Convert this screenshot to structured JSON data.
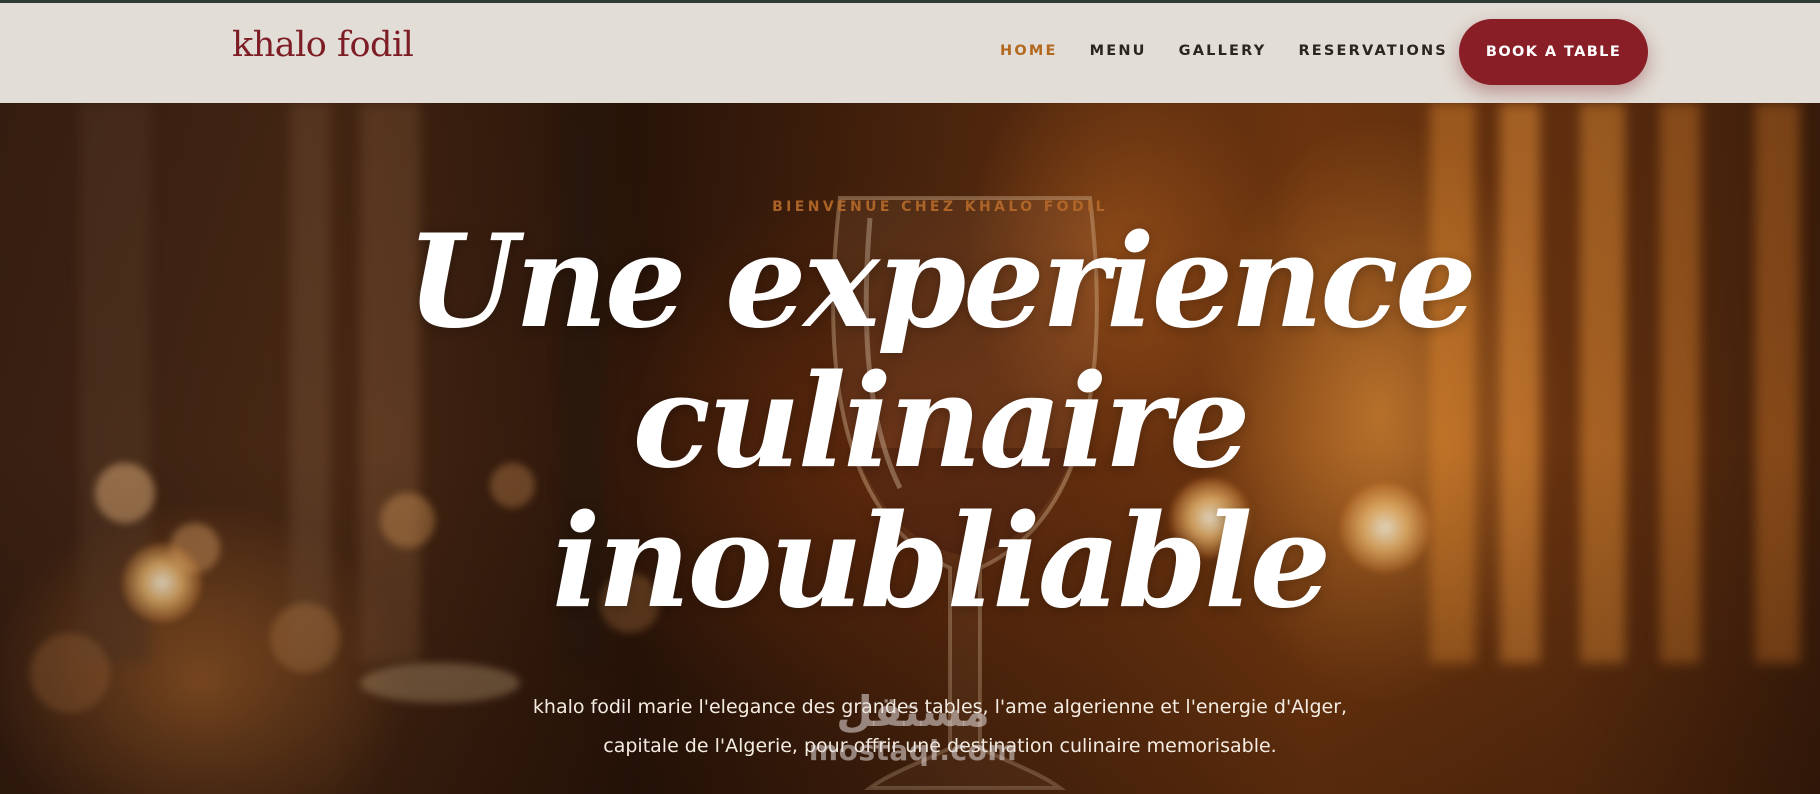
{
  "header": {
    "logo": "khalo fodil",
    "nav": [
      {
        "label": "HOME",
        "active": true
      },
      {
        "label": "MENU",
        "active": false
      },
      {
        "label": "GALLERY",
        "active": false
      },
      {
        "label": "RESERVATIONS",
        "active": false
      }
    ],
    "cta_label": "BOOK A TABLE"
  },
  "hero": {
    "eyebrow": "BIENVENUE CHEZ KHALO FODIL",
    "headline_lines": [
      "Une experience",
      "culinaire",
      "inoubliable"
    ],
    "subtext_lines": [
      "khalo fodil marie l'elegance des grandes tables, l'ame algerienne et l'energie d'Alger,",
      "capitale de l'Algerie, pour offrir une destination culinaire memorisable."
    ]
  },
  "watermark": {
    "arabic": "مستقل",
    "latin": "mostaql.com"
  },
  "colors": {
    "header_bg": "#e2ddd6",
    "brand": "#7d1d26",
    "cta_bg": "#8a1e27",
    "nav_active": "#b3681f",
    "nav_text": "#2a2520",
    "eyebrow": "#b76a2a"
  }
}
